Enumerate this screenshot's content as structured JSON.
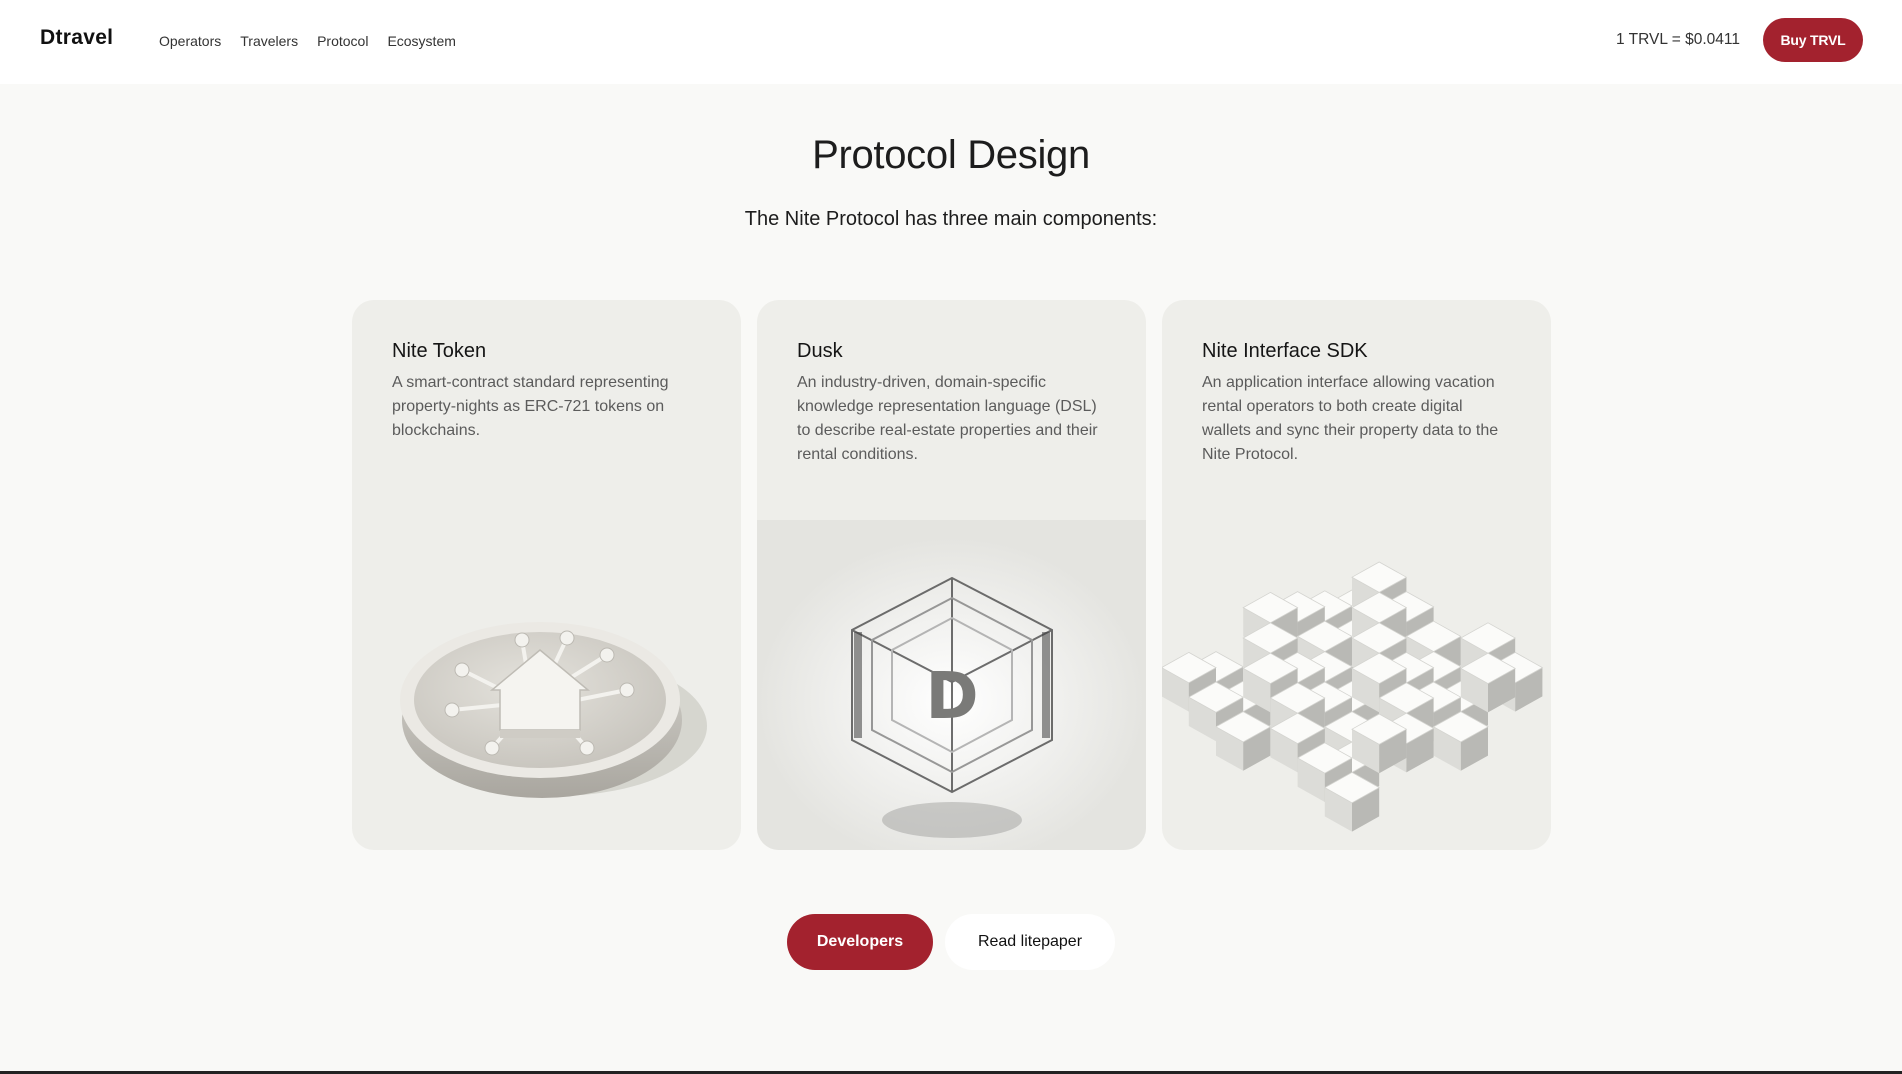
{
  "header": {
    "logo": "Dtravel",
    "nav": [
      {
        "label": "Operators"
      },
      {
        "label": "Travelers"
      },
      {
        "label": "Protocol"
      },
      {
        "label": "Ecosystem"
      }
    ],
    "price": "1 TRVL = $0.0411",
    "buy_label": "Buy TRVL"
  },
  "section": {
    "title": "Protocol Design",
    "subtitle": "The Nite Protocol has three main components:"
  },
  "cards": [
    {
      "title": "Nite Token",
      "description": "A smart-contract standard representing property-nights as ERC-721 tokens on blockchains.",
      "illustration": "house-coin-illustration"
    },
    {
      "title": "Dusk",
      "description": "An industry-driven, domain-specific knowledge representation language (DSL) to describe real-estate properties and their rental conditions.",
      "illustration": "glass-cube-d-illustration"
    },
    {
      "title": "Nite Interface SDK",
      "description": "An application interface allowing vacation rental operators to both create digital wallets and sync their property data to the Nite Protocol.",
      "illustration": "cube-grid-illustration"
    }
  ],
  "actions": {
    "primary_label": "Developers",
    "secondary_label": "Read litepaper"
  },
  "colors": {
    "accent": "#a3222e",
    "card_background": "#eeeeea",
    "page_background": "#f9f9f7"
  }
}
